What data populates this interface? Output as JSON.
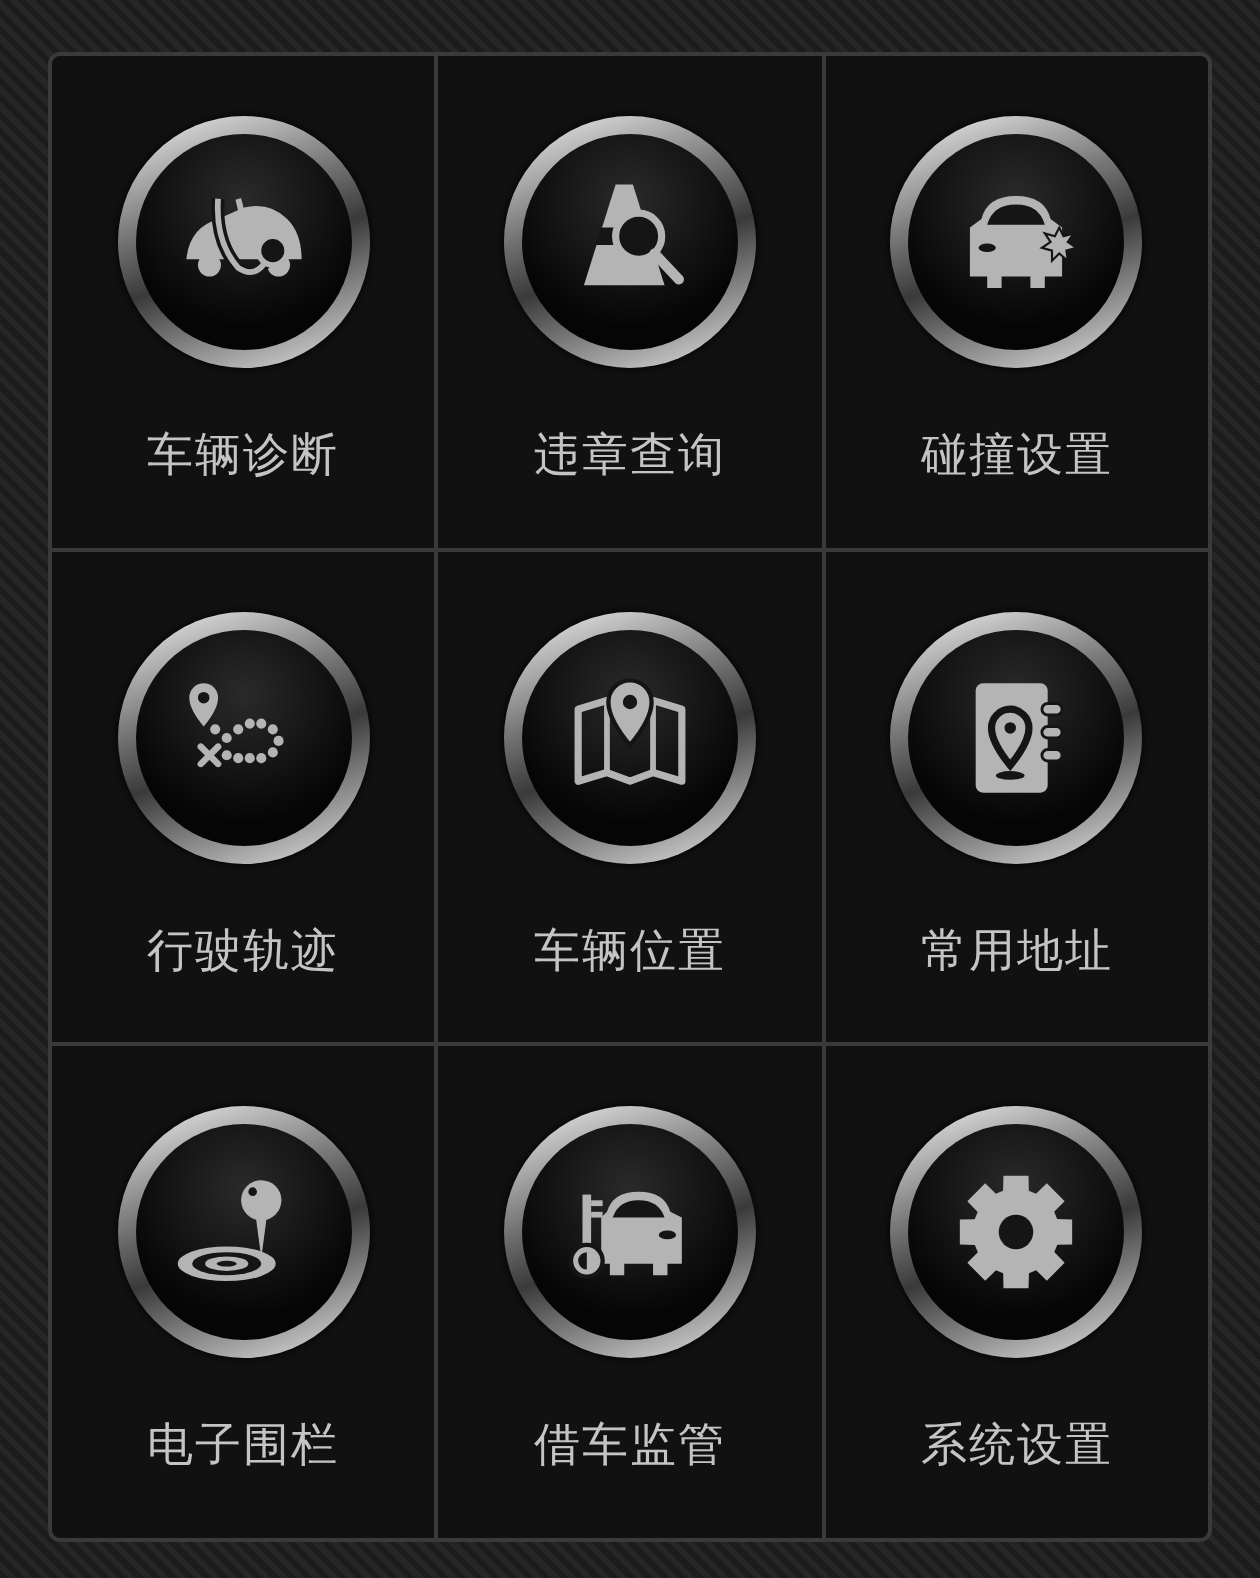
{
  "tiles": [
    {
      "kind": "diagnosis",
      "label": "车辆诊断"
    },
    {
      "kind": "violation",
      "label": "违章查询"
    },
    {
      "kind": "collision",
      "label": "碰撞设置"
    },
    {
      "kind": "track",
      "label": "行驶轨迹"
    },
    {
      "kind": "location",
      "label": "车辆位置"
    },
    {
      "kind": "address",
      "label": "常用地址"
    },
    {
      "kind": "fence",
      "label": "电子围栏"
    },
    {
      "kind": "lending",
      "label": "借车监管"
    },
    {
      "kind": "settings",
      "label": "系统设置"
    }
  ]
}
